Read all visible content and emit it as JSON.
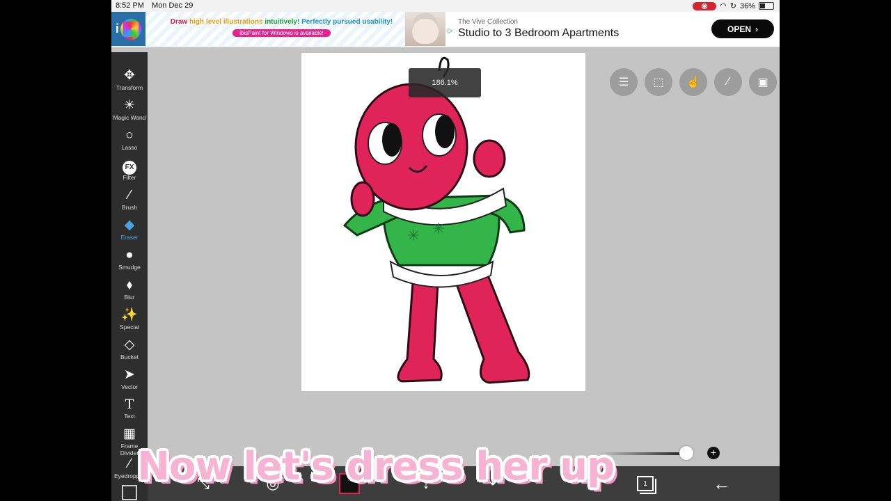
{
  "status_bar": {
    "time": "8:52 PM",
    "date": "Mon Dec 29",
    "battery": "36%"
  },
  "ad": {
    "promo_parts": [
      "Draw ",
      "high level illustrations ",
      "intuitively! ",
      "Perfectly pursued usability!"
    ],
    "promo_sub": "ibisPaint for Windows is available!",
    "sponsor": "The Vive Collection",
    "headline": "Studio to 3 Bedroom Apartments",
    "cta": "OPEN"
  },
  "toolbar": {
    "tools": [
      {
        "label": "Transform",
        "icon": "move-icon"
      },
      {
        "label": "Magic Wand",
        "icon": "magic-wand-icon"
      },
      {
        "label": "Lasso",
        "icon": "lasso-icon"
      },
      {
        "label": "Filter",
        "icon": "fx-icon"
      },
      {
        "label": "Brush",
        "icon": "brush-icon"
      },
      {
        "label": "Eraser",
        "icon": "eraser-icon",
        "active": true
      },
      {
        "label": "Smudge",
        "icon": "smudge-icon"
      },
      {
        "label": "Blur",
        "icon": "blur-drop-icon"
      },
      {
        "label": "Special",
        "icon": "sparkle-icon"
      },
      {
        "label": "Bucket",
        "icon": "bucket-icon"
      },
      {
        "label": "Vector",
        "icon": "arrow-cursor-icon"
      },
      {
        "label": "Text",
        "icon": "text-icon"
      },
      {
        "label": "Frame Divider",
        "icon": "frame-divider-icon"
      },
      {
        "label": "Eyedropper",
        "icon": "eyedropper-icon"
      }
    ],
    "active_color": "#4aa3df"
  },
  "canvas": {
    "zoom_label": "186.1%"
  },
  "floating_buttons": [
    "toggle-icon",
    "selection-icon",
    "touch-icon",
    "ruler-icon",
    "reference-image-icon"
  ],
  "brush_slider": {
    "level": 0.93
  },
  "bottom_bar": {
    "layer_count": "1"
  },
  "caption": "Now let's dress her up"
}
